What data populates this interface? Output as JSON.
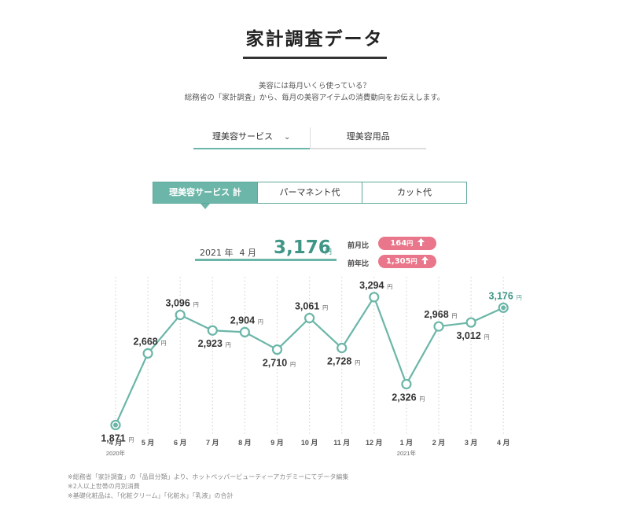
{
  "header": {
    "title": "家計調査データ"
  },
  "intro": {
    "line1": "美容には毎月いくら使っている？",
    "line2": "総務省の「家計調査」から、毎月の美容アイテムの消費動向をお伝えします。"
  },
  "tabs": [
    {
      "label": "理美容サービス",
      "active": true
    },
    {
      "label": "理美容用品",
      "active": false
    }
  ],
  "subtabs": [
    {
      "label": "理美容サービス 計",
      "active": true
    },
    {
      "label": "パーマネント代",
      "active": false
    },
    {
      "label": "カット代",
      "active": false
    }
  ],
  "current": {
    "year": "2021 年",
    "month": "4 月",
    "value": "3,176",
    "unit": "円"
  },
  "comparisons": [
    {
      "label": "前月比",
      "value": "164",
      "unit": "円"
    },
    {
      "label": "前年比",
      "value": "1,305",
      "unit": "円"
    }
  ],
  "colors": {
    "accent": "#6bb6a8",
    "accent_dark": "#3f9686",
    "badge": "#e9768a"
  },
  "icons": {
    "dropdown": "chevron-down-icon",
    "increase": "arrow-up-icon"
  },
  "chart_data": {
    "type": "line",
    "categories": [
      "4 月",
      "5 月",
      "6 月",
      "7 月",
      "8 月",
      "9 月",
      "10 月",
      "11 月",
      "12 月",
      "1 月",
      "2 月",
      "3 月",
      "4 月"
    ],
    "year_labels": [
      {
        "index": 0,
        "label": "2020年"
      },
      {
        "index": 9,
        "label": "2021年"
      }
    ],
    "values": [
      1871,
      2668,
      3096,
      2923,
      2904,
      2710,
      3061,
      2728,
      3294,
      2326,
      2968,
      3012,
      3176
    ],
    "value_labels": [
      "1,871",
      "2,668",
      "3,096",
      "2,923",
      "2,904",
      "2,710",
      "3,061",
      "2,728",
      "3,294",
      "2,326",
      "2,968",
      "3,012",
      "3,176"
    ],
    "unit": "円",
    "label_positions": [
      "below",
      "above",
      "above",
      "below",
      "above",
      "below",
      "above",
      "below",
      "above",
      "below",
      "above",
      "below",
      "above"
    ],
    "highlight_index": 12,
    "grid": "vertical-dotted"
  },
  "notes": [
    "※総務省「家計調査」の「品目分類」より、ホットペッパービューティーアカデミーにてデータ編集",
    "※2人以上世帯の月別消費",
    "※基礎化粧品は、「化粧クリーム」「化粧水」「乳液」の合計"
  ]
}
